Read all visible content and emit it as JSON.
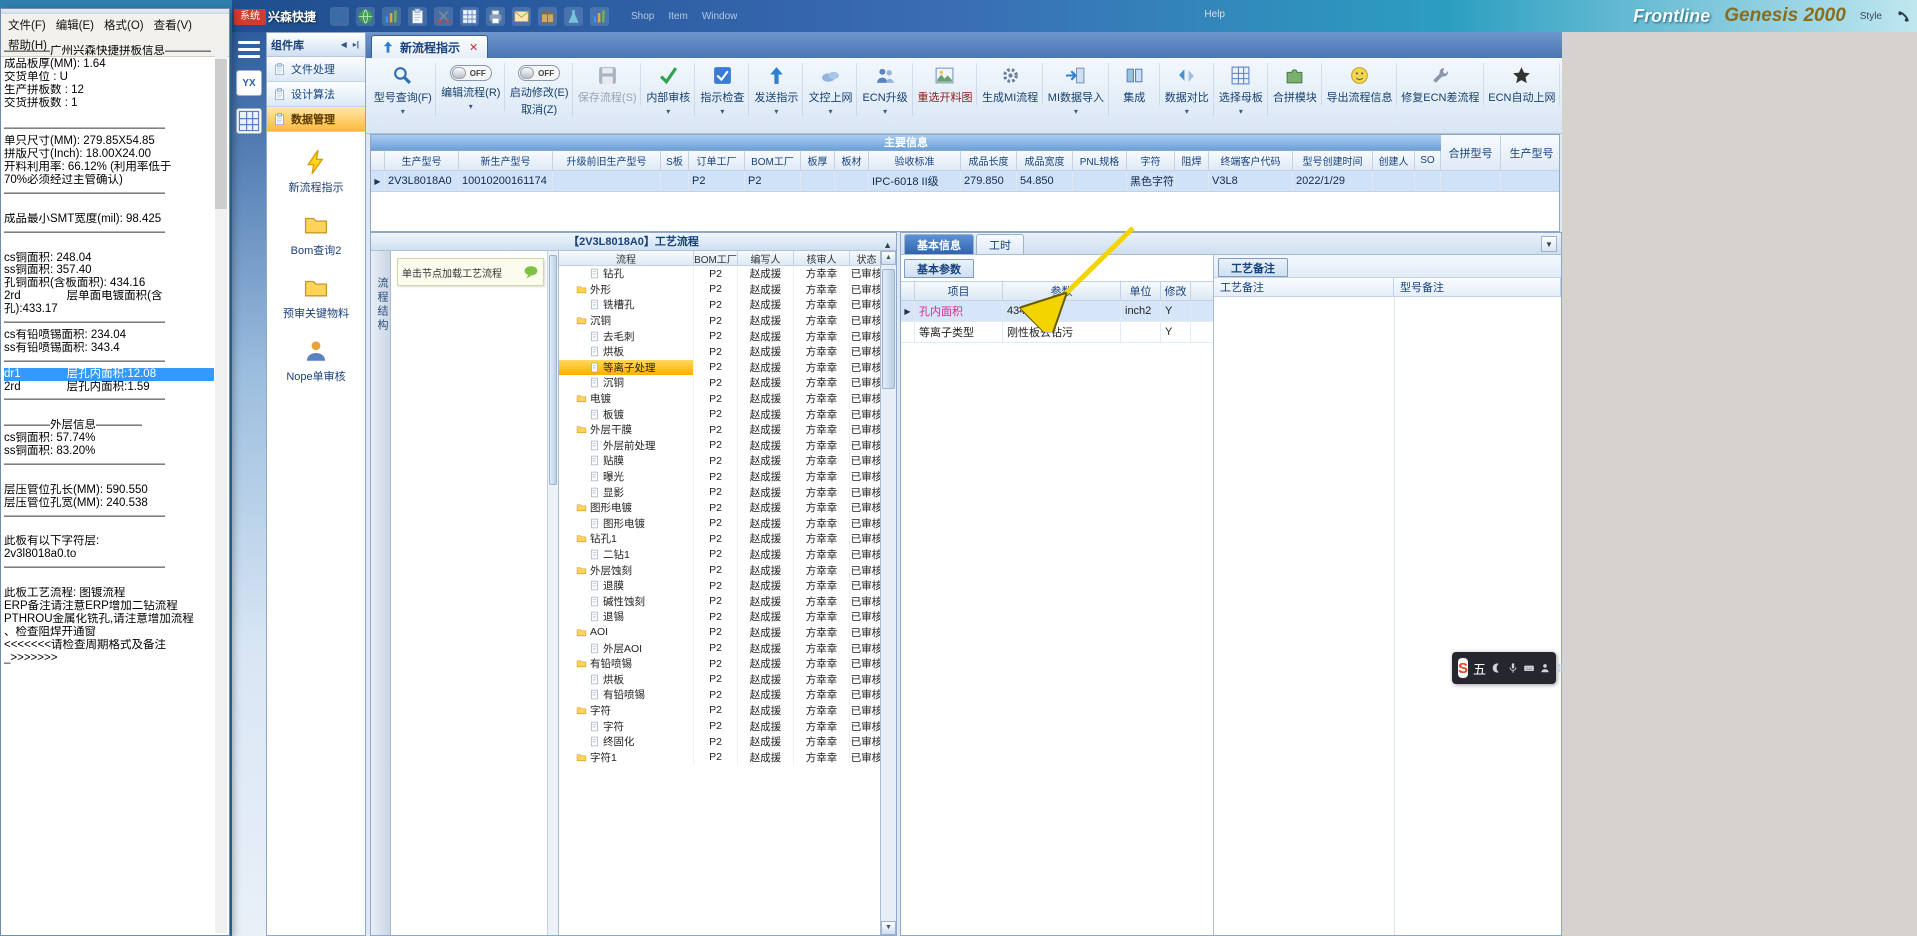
{
  "notepad": {
    "menu_items": [
      "文件(F)",
      "编辑(E)",
      "格式(O)",
      "查看(V)",
      "帮助(H)"
    ],
    "selected_index": 25,
    "lines": [
      "————广州兴森快捷拼板信息————",
      "成品板厚(MM): 1.64",
      "交货单位 : U",
      "生产拼板数 : 12",
      "交货拼板数 : 1",
      "",
      "——————————————",
      "单只尺寸(MM): 279.85X54.85",
      "拼版尺寸(Inch): 18.00X24.00",
      "开料利用率: 66.12% (利用率低于",
      "70%必须经过主管确认)",
      "——————————————",
      "",
      "成品最小SMT宽度(mil): 98.425",
      "——————————————",
      "",
      "cs铜面积: 248.04",
      "ss铜面积: 357.40",
      "孔铜面积(含板面积): 434.16",
      "2rd　　　　层单面电镀面积(含",
      "孔):433.17",
      "——————————————",
      "cs有铅喷锡面积: 234.04",
      "ss有铅喷锡面积: 343.4",
      "——————————————",
      "dr1　　　　层孔内面积:12.08",
      "2rd　　　　层孔内面积:1.59",
      "——————————————",
      "",
      "————外层信息————",
      "cs铜面积: 57.74%",
      "ss铜面积: 83.20%",
      "——————————————",
      "",
      "层压管位孔长(MM): 590.550",
      "层压管位孔宽(MM): 240.538",
      "——————————————",
      "",
      "此板有以下字符层:",
      "2v3l8018a0.to",
      "——————————————",
      "",
      "此板工艺流程: 图镀流程",
      "ERP备注请注意ERP增加二钻流程",
      "PTHROU金属化铣孔,请注意增加流程",
      "、检查阻焊开通窗",
      "<<<<<<<请检查周期格式及备注",
      "_>>>>>>>"
    ]
  },
  "titlebar": {
    "app_name": "兴森快捷",
    "system_button": "系统",
    "menus": [
      "Shop",
      "Item",
      "Window"
    ],
    "help": "Help",
    "icons": [
      "search-icon",
      "globe-icon",
      "stats-icon",
      "clipboard-icon",
      "scissors-icon",
      "grid-icon",
      "printer-icon",
      "mail-icon",
      "package-icon",
      "flask-icon",
      "chart-icon"
    ],
    "brand_frontline": "Frontline",
    "brand_genesis": "Genesis 2000",
    "brand_style": "Style"
  },
  "left_rail": {
    "yx_label": "YX"
  },
  "component_panel": {
    "title": "组件库",
    "groups": [
      {
        "label": "文件处理",
        "active": false
      },
      {
        "label": "设计算法",
        "active": false
      },
      {
        "label": "数据管理",
        "active": true
      }
    ],
    "items": [
      {
        "label": "新流程指示",
        "icon": "lightning-icon"
      },
      {
        "label": "Bom查询2",
        "icon": "folder-icon"
      },
      {
        "label": "预审关键物料",
        "icon": "folder-icon"
      },
      {
        "label": "Nope单审核",
        "icon": "person-icon"
      }
    ]
  },
  "doc_tab": {
    "label": "新流程指示"
  },
  "ribbon": {
    "buttons": [
      {
        "id": "model-query",
        "label": "型号查询(F)",
        "icon": "search-icon",
        "dropdown": true
      },
      {
        "id": "edit-flow",
        "label": "编辑流程(R)",
        "toggle": "OFF",
        "dropdown": true
      },
      {
        "id": "start-modify",
        "label": "启动修改(E)",
        "label2": "取消(Z)",
        "toggle": "OFF"
      },
      {
        "id": "save-flow",
        "label": "保存流程(S)",
        "icon": "save-icon",
        "disabled": true
      },
      {
        "id": "internal-audit",
        "label": "内部审核",
        "icon": "check-icon",
        "dropdown": true
      },
      {
        "id": "instruction-check",
        "label": "指示检查",
        "icon": "checkbox-icon",
        "dropdown": true
      },
      {
        "id": "send-instruction",
        "label": "发送指示",
        "icon": "send-icon",
        "dropdown": true
      },
      {
        "id": "doc-upload",
        "label": "文控上网",
        "icon": "cloud-icon",
        "dropdown": true
      },
      {
        "id": "ecn-upgrade",
        "label": "ECN升级",
        "icon": "people-icon",
        "dropdown": true
      },
      {
        "id": "reselect-material",
        "label": "重选开料图",
        "icon": "image-icon",
        "warn": true
      },
      {
        "id": "gen-mi-flow",
        "label": "生成MI流程",
        "icon": "gear-icon"
      },
      {
        "id": "mi-data-import",
        "label": "MI数据导入",
        "icon": "import-icon",
        "dropdown": true
      },
      {
        "id": "integrate",
        "label": "集成",
        "icon": "merge-icon"
      },
      {
        "id": "data-compare",
        "label": "数据对比",
        "icon": "compare-icon",
        "dropdown": true
      },
      {
        "id": "select-motherboard",
        "label": "选择母板",
        "icon": "board-icon",
        "dropdown": true
      },
      {
        "id": "combine-module",
        "label": "合拼模块",
        "icon": "puzzle-icon"
      },
      {
        "id": "export-flow-info",
        "label": "导出流程信息",
        "icon": "export-icon"
      },
      {
        "id": "fix-ecn-flow",
        "label": "修复ECN差流程",
        "icon": "wrench-icon"
      },
      {
        "id": "ecn-auto-upload",
        "label": "ECN自动上网",
        "icon": "star-icon"
      }
    ]
  },
  "main_info": {
    "band_title": "主要信息",
    "columns": [
      "生产型号",
      "新生产型号",
      "升级前旧生产型号",
      "S板",
      "订单工厂",
      "BOM工厂",
      "板厚",
      "板材",
      "验收标准",
      "成品长度",
      "成品宽度",
      "PNL规格",
      "字符",
      "阻焊",
      "终端客户代码",
      "型号创建时间",
      "创建人",
      "SO"
    ],
    "tall_columns": [
      "合拼型号",
      "生产型号"
    ],
    "row": [
      "2V3L8018A0",
      "10010200161174",
      "",
      "",
      "P2",
      "P2",
      "",
      "",
      "IPC-6018 II级",
      "279.850",
      "54.850",
      "",
      "黑色字符",
      "",
      "V3L8",
      "2022/1/29",
      "",
      "",
      "",
      ""
    ]
  },
  "process_flow": {
    "title": "【2V3L8018A0】工艺流程",
    "side_tab": "流程结构",
    "note": "单击节点加载工艺流程",
    "columns": [
      "流程",
      "BOM工厂",
      "编写人",
      "核审人",
      "状态"
    ],
    "defaults": {
      "bom": "P2",
      "writer": "赵成援",
      "reviewer": "方幸幸",
      "status": "已审核"
    },
    "nodes": [
      {
        "label": "钻孔",
        "level": 2,
        "folder": false
      },
      {
        "label": "外形",
        "level": 1,
        "folder": true
      },
      {
        "label": "铣槽孔",
        "level": 2,
        "folder": false
      },
      {
        "label": "沉铜",
        "level": 1,
        "folder": true
      },
      {
        "label": "去毛刺",
        "level": 2,
        "folder": false
      },
      {
        "label": "烘板",
        "level": 2,
        "folder": false
      },
      {
        "label": "等离子处理",
        "level": 2,
        "folder": false,
        "highlight": true
      },
      {
        "label": "沉铜",
        "level": 2,
        "folder": false
      },
      {
        "label": "电镀",
        "level": 1,
        "folder": true
      },
      {
        "label": "板镀",
        "level": 2,
        "folder": false
      },
      {
        "label": "外层干膜",
        "level": 1,
        "folder": true
      },
      {
        "label": "外层前处理",
        "level": 2,
        "folder": false
      },
      {
        "label": "贴膜",
        "level": 2,
        "folder": false
      },
      {
        "label": "曝光",
        "level": 2,
        "folder": false
      },
      {
        "label": "显影",
        "level": 2,
        "folder": false
      },
      {
        "label": "图形电镀",
        "level": 1,
        "folder": true
      },
      {
        "label": "图形电镀",
        "level": 2,
        "folder": false
      },
      {
        "label": "钻孔1",
        "level": 1,
        "folder": true
      },
      {
        "label": "二钻1",
        "level": 2,
        "folder": false
      },
      {
        "label": "外层蚀刻",
        "level": 1,
        "folder": true
      },
      {
        "label": "退膜",
        "level": 2,
        "folder": false
      },
      {
        "label": "碱性蚀刻",
        "level": 2,
        "folder": false
      },
      {
        "label": "退锡",
        "level": 2,
        "folder": false
      },
      {
        "label": "AOI",
        "level": 1,
        "folder": true
      },
      {
        "label": "外层AOI",
        "level": 2,
        "folder": false
      },
      {
        "label": "有铅喷锡",
        "level": 1,
        "folder": true
      },
      {
        "label": "烘板",
        "level": 2,
        "folder": false
      },
      {
        "label": "有铅喷锡",
        "level": 2,
        "folder": false
      },
      {
        "label": "字符",
        "level": 1,
        "folder": true
      },
      {
        "label": "字符",
        "level": 2,
        "folder": false
      },
      {
        "label": "终固化",
        "level": 2,
        "folder": false
      },
      {
        "label": "字符1",
        "level": 1,
        "folder": true
      }
    ]
  },
  "detail_panel": {
    "tabs": [
      {
        "label": "基本信息",
        "active": true
      },
      {
        "label": "工时",
        "active": false
      }
    ],
    "sub_tab": "基本参数",
    "columns": [
      "项目",
      "参数",
      "单位",
      "修改"
    ],
    "rows": [
      {
        "item": "孔内面积",
        "value": "434.16",
        "unit": "inch2",
        "modify": "Y",
        "selected": true
      },
      {
        "item": "等离子类型",
        "value": "刚性板去钻污",
        "unit": "",
        "modify": "Y",
        "selected": false
      }
    ]
  },
  "notes_panel": {
    "tab": "工艺备注",
    "columns": [
      "工艺备注",
      "型号备注"
    ]
  },
  "ime_bar": {
    "logo": "S",
    "mode": "五",
    "icons": [
      "moon-icon",
      "mic-icon",
      "keyboard-icon",
      "user-icon",
      "grid4-icon"
    ]
  }
}
